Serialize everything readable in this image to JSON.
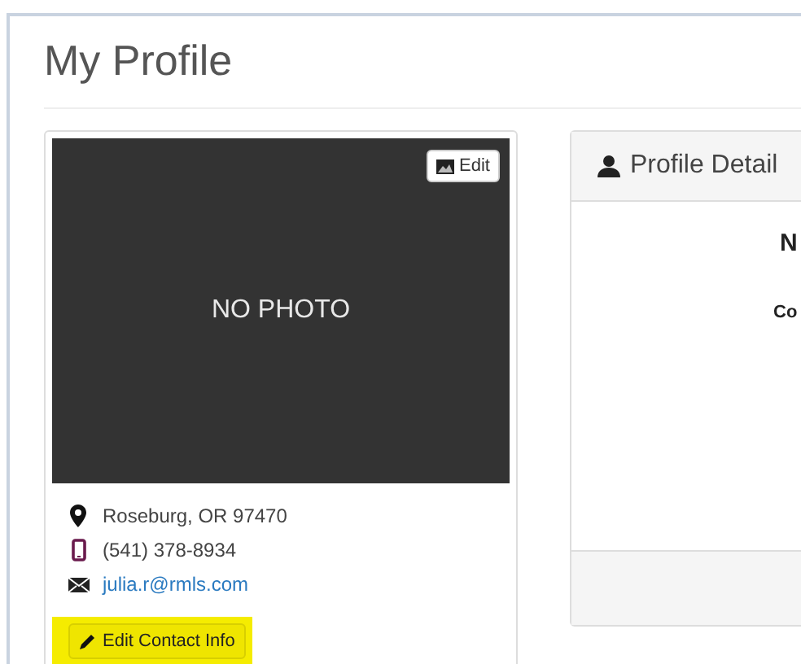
{
  "page_title": "My Profile",
  "photo_card": {
    "placeholder_text": "NO PHOTO",
    "edit_button": "Edit",
    "contact": [
      {
        "kind": "location",
        "text": "Roseburg, OR 97470"
      },
      {
        "kind": "phone",
        "text": "(541) 378-8934"
      },
      {
        "kind": "email",
        "text": "julia.r@rmls.com"
      }
    ],
    "edit_contact_button": {
      "label": "Edit Contact Info",
      "highlighted": true
    }
  },
  "details_panel": {
    "title": "Profile Detail",
    "heading": "N",
    "label": "Co"
  }
}
